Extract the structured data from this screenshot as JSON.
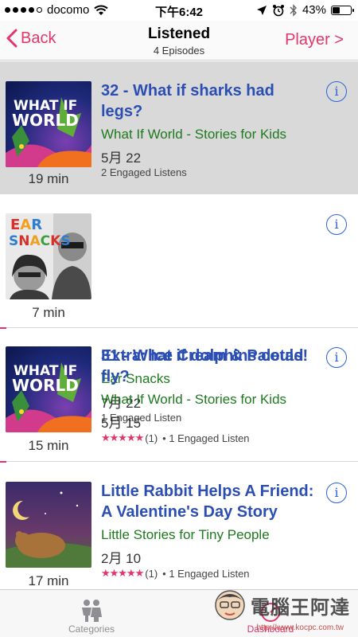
{
  "status": {
    "carrier": "docomo",
    "time": "下午6:42",
    "battery": "43%",
    "battery_level": 0.43
  },
  "nav": {
    "back_label": "Back",
    "title": "Listened",
    "subtitle": "4 Episodes",
    "right_label": "Player >"
  },
  "episodes": [
    {
      "title": "32 - What if sharks had legs?",
      "podcast": "What If World - Stories for Kids",
      "date": "5月 22",
      "meta": "2 Engaged Listens",
      "duration": "19 min",
      "art_text": "WHAT IF WORLD",
      "selected": true
    },
    {
      "title": "Extra: Ice Cream & Paletas!",
      "podcast": "Ear Snacks",
      "date": "7月 22",
      "meta": "1 Engaged Listen",
      "duration": "7 min",
      "art_text_1": "EAR",
      "art_text_2": "SNACKS"
    },
    {
      "title": "31 - What if dolphins could fly?",
      "podcast": "What If World - Stories for Kids",
      "date": "5月 15",
      "stars": "★★★★★",
      "rating_count": "(1)",
      "meta": "• 1 Engaged Listen",
      "duration": "15 min",
      "art_text": "WHAT IF WORLD"
    },
    {
      "title": "Little Rabbit Helps A Friend: A Valentine's Day Story",
      "podcast": "Little Stories for Tiny People",
      "date": "2月 10",
      "stars": "★★★★★",
      "rating_count": "(1)",
      "meta": "• 1 Engaged Listen",
      "duration": "17 min"
    }
  ],
  "info_glyph": "i",
  "tabs": {
    "categories": "Categories",
    "dashboard": "Dashboard"
  },
  "watermark": {
    "text": "電腦王阿達",
    "url": "http://www.kocpc.com.tw"
  },
  "colors": {
    "accent": "#e1366a",
    "title_blue": "#2b4eb3",
    "podcast_green": "#1e7a1e",
    "info_blue": "#2b64d6"
  }
}
